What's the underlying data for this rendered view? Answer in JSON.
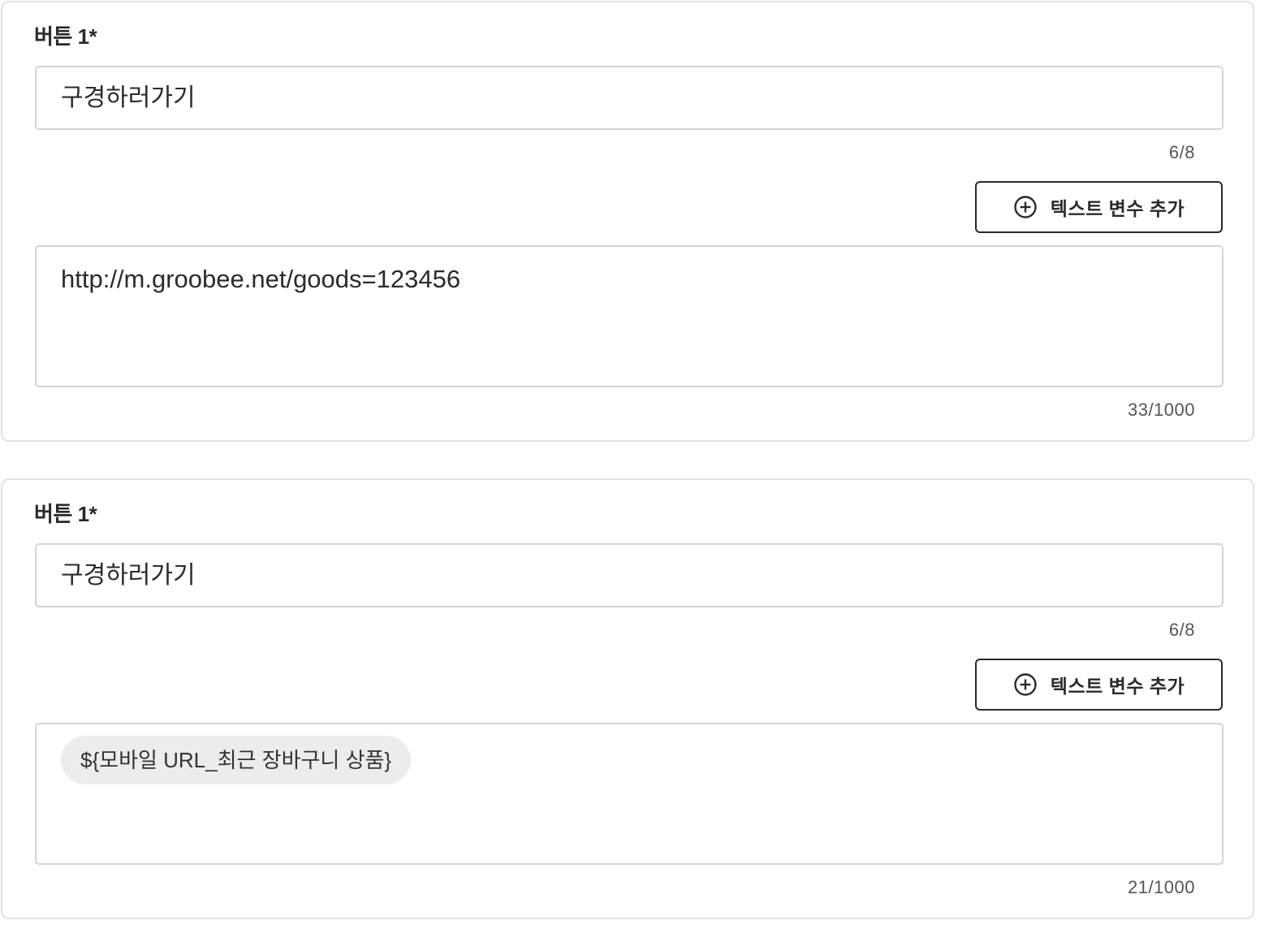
{
  "cards": [
    {
      "label": "버튼 1*",
      "name_value": "구경하러가기",
      "name_counter": "6/8",
      "add_variable_label": "텍스트 변수 추가",
      "url_value": "http://m.groobee.net/goods=123456",
      "url_counter": "33/1000"
    },
    {
      "label": "버튼 1*",
      "name_value": "구경하러가기",
      "name_counter": "6/8",
      "add_variable_label": "텍스트 변수 추가",
      "url_chip": "${모바일 URL_최근 장바구니 상품}",
      "url_counter": "21/1000"
    }
  ],
  "icons": {
    "add": "plus-circle-icon"
  },
  "colors": {
    "border": "#d4d4d4",
    "card_border": "#e2e2e2",
    "chip_bg": "#ececec",
    "text": "#222222",
    "button_border": "#2a2a2a"
  }
}
